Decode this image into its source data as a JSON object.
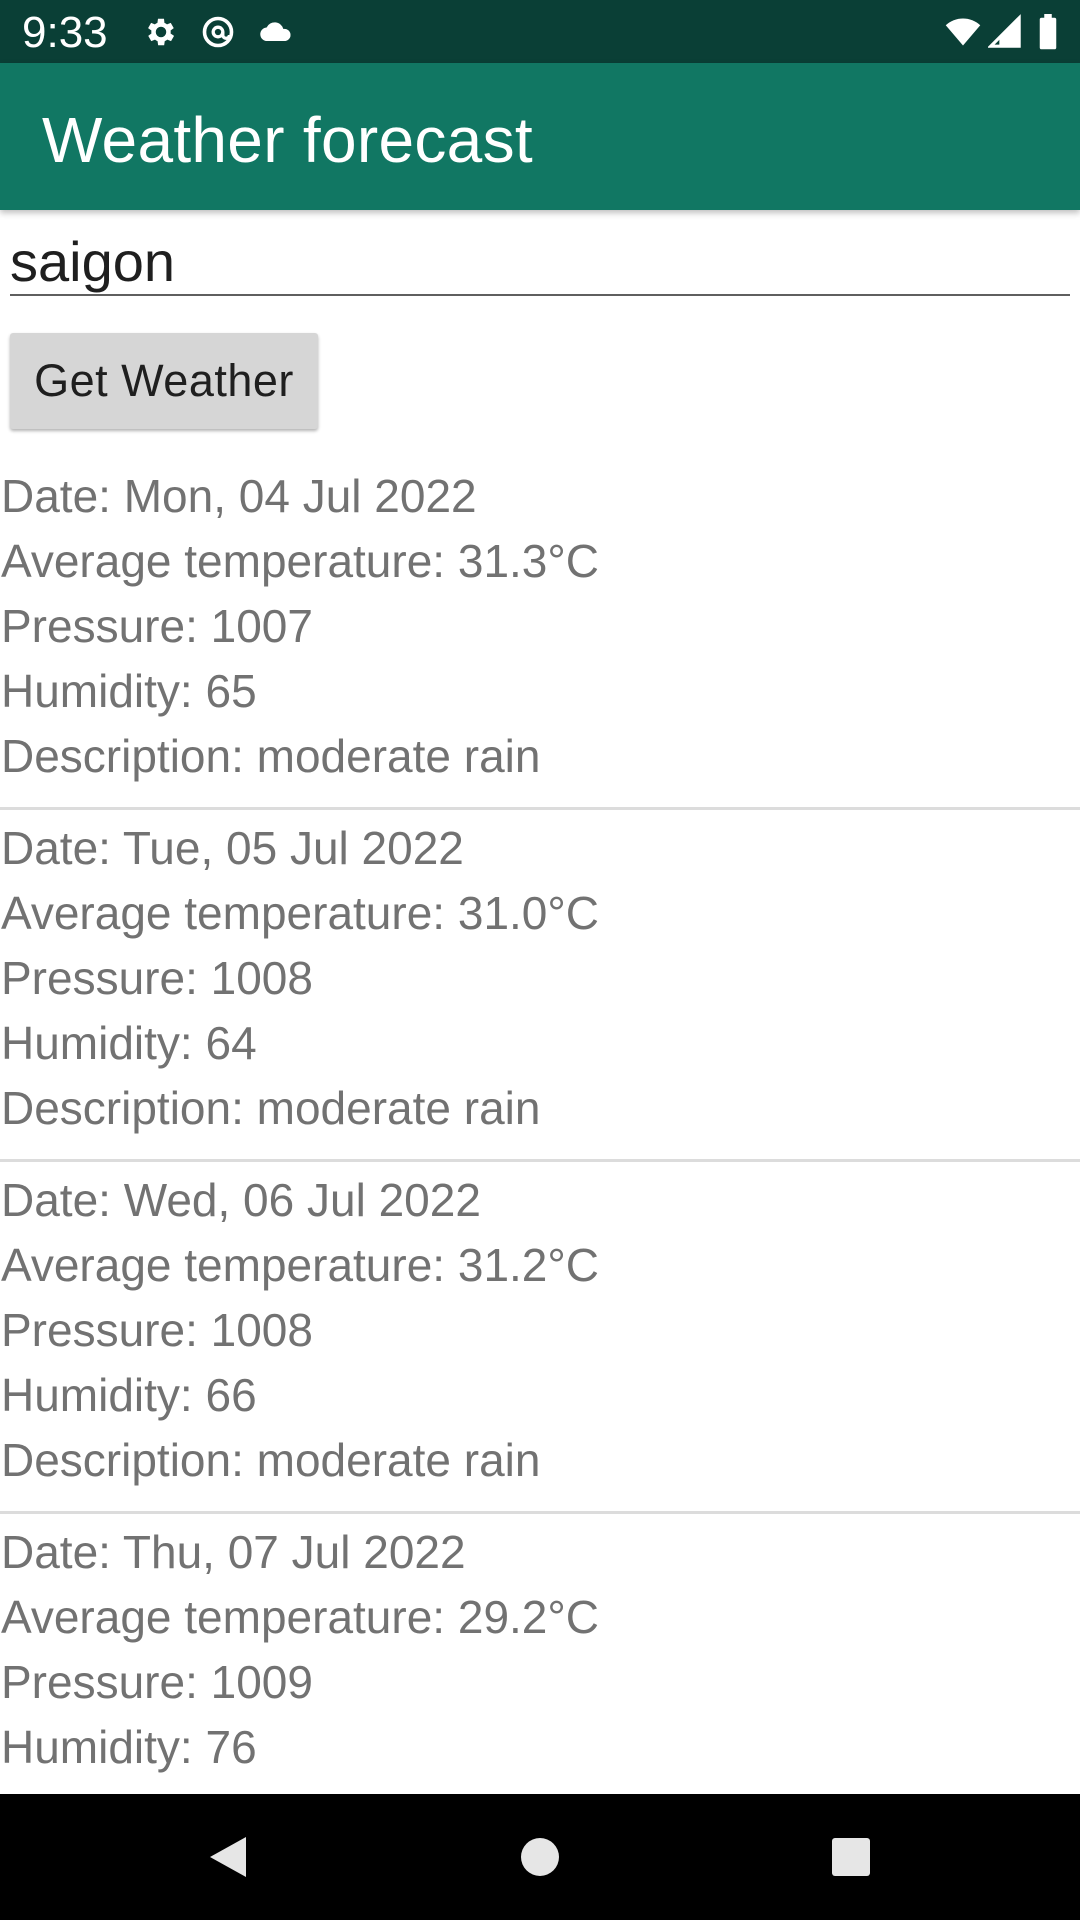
{
  "status_bar": {
    "time": "9:33",
    "icons_left": [
      "settings-icon",
      "at-sign-icon",
      "cloud-icon"
    ],
    "icons_right": [
      "wifi-icon",
      "cell-signal-icon",
      "battery-icon"
    ]
  },
  "app_bar": {
    "title": "Weather forecast",
    "color": "#117763"
  },
  "search": {
    "value": "saigon"
  },
  "button": {
    "label": "Get Weather"
  },
  "forecasts": [
    {
      "date": "Date: Mon, 04 Jul 2022",
      "temperature": "Average temperature: 31.3°C",
      "pressure": "Pressure: 1007",
      "humidity": "Humidity: 65",
      "description": "Description: moderate rain"
    },
    {
      "date": "Date: Tue, 05 Jul 2022",
      "temperature": "Average temperature: 31.0°C",
      "pressure": "Pressure: 1008",
      "humidity": "Humidity: 64",
      "description": "Description: moderate rain"
    },
    {
      "date": "Date: Wed, 06 Jul 2022",
      "temperature": "Average temperature: 31.2°C",
      "pressure": "Pressure: 1008",
      "humidity": "Humidity: 66",
      "description": "Description: moderate rain"
    },
    {
      "date": "Date: Thu, 07 Jul 2022",
      "temperature": "Average temperature: 29.2°C",
      "pressure": "Pressure: 1009",
      "humidity": "Humidity: 76"
    }
  ],
  "nav_bar": {
    "buttons": [
      "back-icon",
      "home-icon",
      "recents-icon"
    ]
  }
}
